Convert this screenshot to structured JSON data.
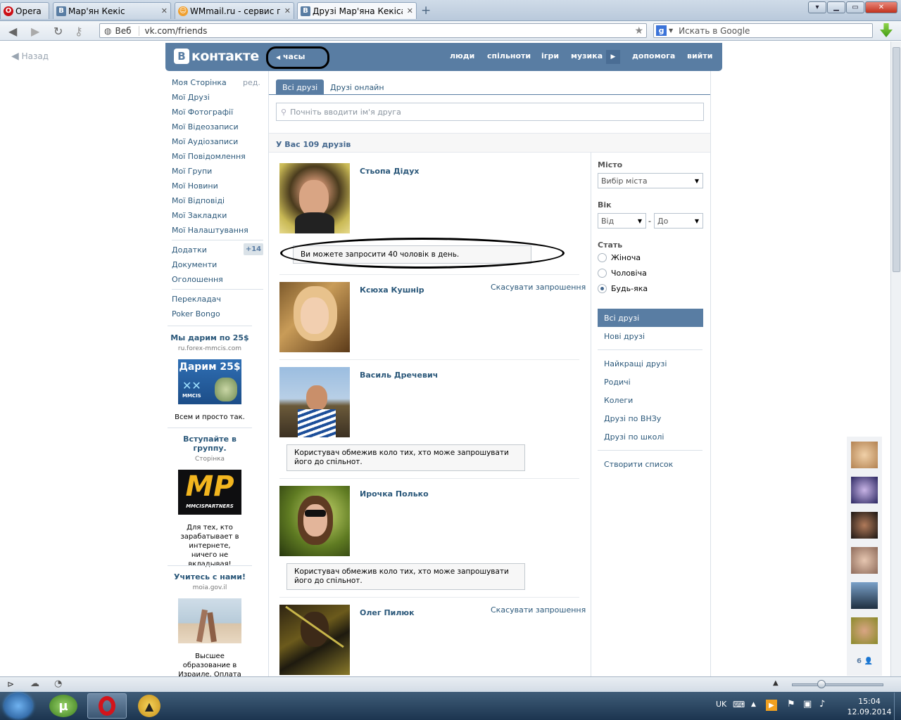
{
  "browser": {
    "menu_label": "Opera",
    "tabs": [
      {
        "label": "Мар'ян Кекіс",
        "icon": "vk-favicon-icon"
      },
      {
        "label": "WMmail.ru - сервис п...",
        "icon": "wmmail-favicon-icon"
      },
      {
        "label": "Друзі Мар'яна Кекіса |...",
        "icon": "vk-favicon-icon"
      }
    ],
    "address": "vk.com/friends",
    "address_badge": "Веб",
    "search_placeholder": "Искать в Google",
    "search_engine_letter": "g"
  },
  "vk": {
    "back_label": "Назад",
    "logo_letter": "В",
    "logo_text": "контакте",
    "clock_widget": "часы",
    "nav": [
      "люди",
      "спільноти",
      "ігри",
      "музика",
      "допомога",
      "вийти"
    ],
    "left_menu": {
      "items": [
        "Моя Сторінка",
        "Мої Друзі",
        "Мої Фотографії",
        "Мої Відеозаписи",
        "Мої Аудіозаписи",
        "Мої Повідомлення",
        "Мої Групи",
        "Мої Новини",
        "Мої Відповіді",
        "Мої Закладки",
        "Мої Налаштування"
      ],
      "edit_label": "ред.",
      "secondary": [
        "Додатки",
        "Документи",
        "Оголошення"
      ],
      "apps_count": "+14",
      "extra": [
        "Перекладач",
        "Poker Bongo"
      ]
    },
    "ads": [
      {
        "title": "Мы дарим по 25$",
        "subtitle": "ru.forex-mmcis.com",
        "image_text": "Дарим 25$",
        "image_brand": "MMCIS",
        "text": "Всем и просто так."
      },
      {
        "title": "Вступайте в группу.",
        "subtitle": "Сторінка",
        "image_text": "MP",
        "image_brand": "MMCISPARTNERS",
        "text": "Для тех, кто зарабатывает в интернете, ничего не вкладывая!"
      },
      {
        "title": "Учитесь с нами!",
        "subtitle": "moia.gov.il",
        "text": "Высшее образование в Израиле. Оплата обучения!"
      }
    ],
    "content": {
      "tabs": [
        "Всі друзі",
        "Друзі онлайн"
      ],
      "search_placeholder": "Почніть вводити ім'я друга",
      "count_header": "У Вас 109 друзів",
      "friends": [
        {
          "name": "Стьопа Дідух",
          "action": "",
          "notice": "Ви можете запросити 40 чоловік в день."
        },
        {
          "name": "Ксюха Кушнір",
          "action": "Скасувати запрошення",
          "notice": ""
        },
        {
          "name": "Василь Дречевич",
          "action": "",
          "notice": "Користувач обмежив коло тих, хто може запрошувати його до спільнот."
        },
        {
          "name": "Ирочка Полько",
          "action": "",
          "notice": "Користувач обмежив коло тих, хто може запрошувати його до спільнот."
        },
        {
          "name": "Олег Пилюк",
          "action": "Скасувати запрошення",
          "notice": ""
        }
      ]
    },
    "filters": {
      "city_label": "Місто",
      "city_value": "Вибір міста",
      "age_label": "Вік",
      "age_from": "Від",
      "age_dash": "-",
      "age_to": "До",
      "sex_label": "Стать",
      "sex_options": [
        "Жіноча",
        "Чоловіча",
        "Будь-яка"
      ],
      "sex_selected": "Будь-яка",
      "lists": [
        "Всі друзі",
        "Нові друзі"
      ],
      "lists2": [
        "Найкращі друзі",
        "Родичі",
        "Колеги",
        "Друзі по ВНЗу",
        "Друзі по школі"
      ],
      "create_list": "Створити список"
    },
    "side_strip_count": "6"
  },
  "taskbar": {
    "lang": "UK",
    "time": "15:04",
    "date": "12.09.2014"
  }
}
